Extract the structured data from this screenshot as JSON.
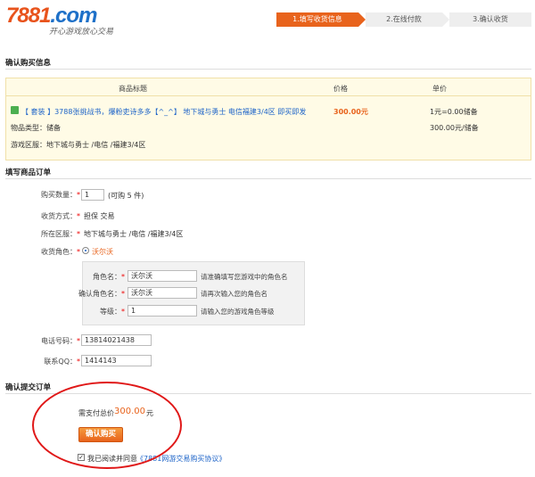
{
  "header": {
    "logo_num": "7881",
    "logo_domain": ".com",
    "slogan": "开心游戏放心交易",
    "steps": [
      "1.填写收货信息",
      "2.在线付款",
      "3.确认收货"
    ]
  },
  "confirm_section": {
    "title": "确认购买信息",
    "col_title": "商品标题",
    "col_price": "价格",
    "col_unit": "单价",
    "product_title": "【 套装 】3788张挑战书，爆粉吏诗多多【^_^】 地下城与勇士 电信福建3/4区 即买即发",
    "price": "300.00元",
    "unit_price_line1": "1元=0.00储备",
    "unit_price_line2": "300.00元/储备",
    "item_type_label": "物品类型：",
    "item_type_value": "储备",
    "region_label": "游戏区服：",
    "region_value": "地下城与勇士 /电信 /福建3/4区"
  },
  "order_section": {
    "title": "填写商品订单",
    "qty_label": "购买数量：",
    "qty_value": "1",
    "qty_hint": "(可购 5 件)",
    "delivery_label": "收货方式：",
    "delivery_value": "担保 交易",
    "region_label": "所在区服：",
    "region_value": "地下城与勇士 /电信 /福建3/4区",
    "role_label": "收货角色：",
    "role_option": "沃尔沃",
    "role_name_label": "角色名：",
    "role_name_value": "沃尔沃",
    "role_name_hint": "请准确填写您游戏中的角色名",
    "confirm_role_label": "确认角色名：",
    "confirm_role_value": "沃尔沃",
    "confirm_role_hint": "请再次输入您的角色名",
    "level_label": "等级：",
    "level_value": "1",
    "level_hint": "请输入您的游戏角色等级",
    "phone_label": "电话号码：",
    "phone_value": "13814021438",
    "qq_label": "联系QQ：",
    "qq_value": "1414143",
    "required_mark": "*"
  },
  "submit_section": {
    "title": "确认提交订单",
    "total_label": "需支付总价",
    "total_value": "300.00",
    "total_unit": "元",
    "confirm_button": "确认购买",
    "agree_text": "我已阅读并同意",
    "agreement_link": "《7881网游交易购买协议》"
  },
  "colors": {
    "accent": "#e8631c",
    "link": "#1e64c8",
    "annotation": "#e01818"
  }
}
